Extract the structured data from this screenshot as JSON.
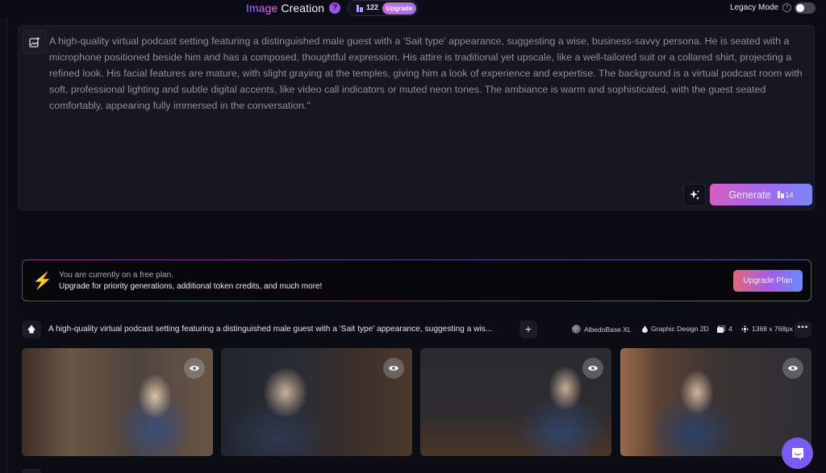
{
  "header": {
    "title_part1": "Image",
    "title_part2": "Creation",
    "help_icon": "question-circle-icon",
    "token_balance": "122",
    "upgrade_label": "Upgrade",
    "legacy_mode_label": "Legacy Mode",
    "legacy_mode_on": false
  },
  "prompt": {
    "image_prompt_icon": "image-add-icon",
    "text": "A high-quality virtual podcast setting featuring a distinguished male guest with a 'Sait type' appearance, suggesting a wise, business-savvy persona. He is seated with a microphone positioned beside him and has a composed, thoughtful expression. His attire is traditional yet upscale, like a well-tailored suit or a collared shirt, projecting a refined look. His facial features are mature, with slight graying at the temples, giving him a look of experience and expertise. The background is a virtual podcast room with soft, professional lighting and subtle digital accents, like video call indicators or muted neon tones. The ambiance is warm and sophisticated, with the guest seated comfortably, appearing fully immersed in the conversation.\"",
    "magic_icon": "sparkle-icon",
    "generate_label": "Generate",
    "generate_cost": "14"
  },
  "plan_banner": {
    "icon": "lightning-icon",
    "line1": "You are currently on a free plan.",
    "line2": "Upgrade for priority generations, additional token credits, and much more!",
    "button_label": "Upgrade Plan"
  },
  "generation": {
    "prompt_preview": "A high-quality virtual podcast setting featuring a distinguished male guest with a 'Sait type' appearance, suggesting a wis...",
    "model": "AlbedoBase XL",
    "style": "Graphic Design 2D",
    "image_count": "4",
    "dimensions": "1368 x 768px",
    "images": [
      {
        "alt": "Man in blue suit with headphones at podcast desk"
      },
      {
        "alt": "Man with glasses and headphones beside microphones"
      },
      {
        "alt": "Man in suit seated at desk with microphone and lamp"
      },
      {
        "alt": "Man in suit with hand on chin beside microphone"
      }
    ]
  },
  "colors": {
    "accent_purple": "#9d6cf0",
    "accent_pink": "#d35ec0",
    "chat_fab": "#7a5cf2"
  }
}
